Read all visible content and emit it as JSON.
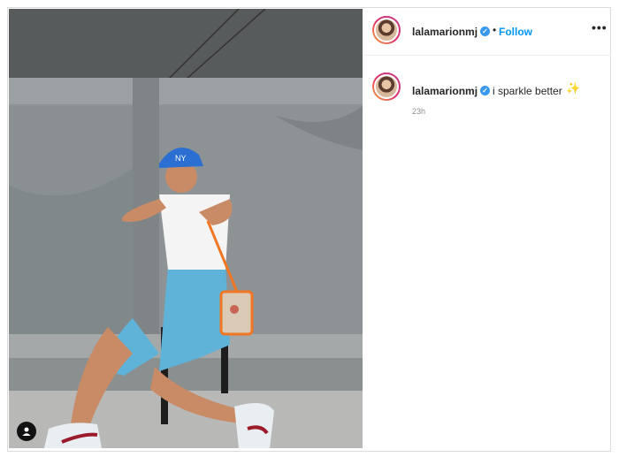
{
  "post": {
    "username": "lalamarionmj",
    "separator": "•",
    "follow_label": "Follow",
    "more_label": "•••",
    "caption_text": "i sparkle better",
    "caption_emoji": "✨",
    "timestamp": "23h"
  },
  "icons": {
    "verified": "verified-badge-icon",
    "user_tag": "user-tag-icon",
    "more": "more-options-icon"
  },
  "colors": {
    "link_blue": "#0095f6",
    "verified_blue": "#3897f0",
    "text_gray": "#8e8e8e"
  }
}
